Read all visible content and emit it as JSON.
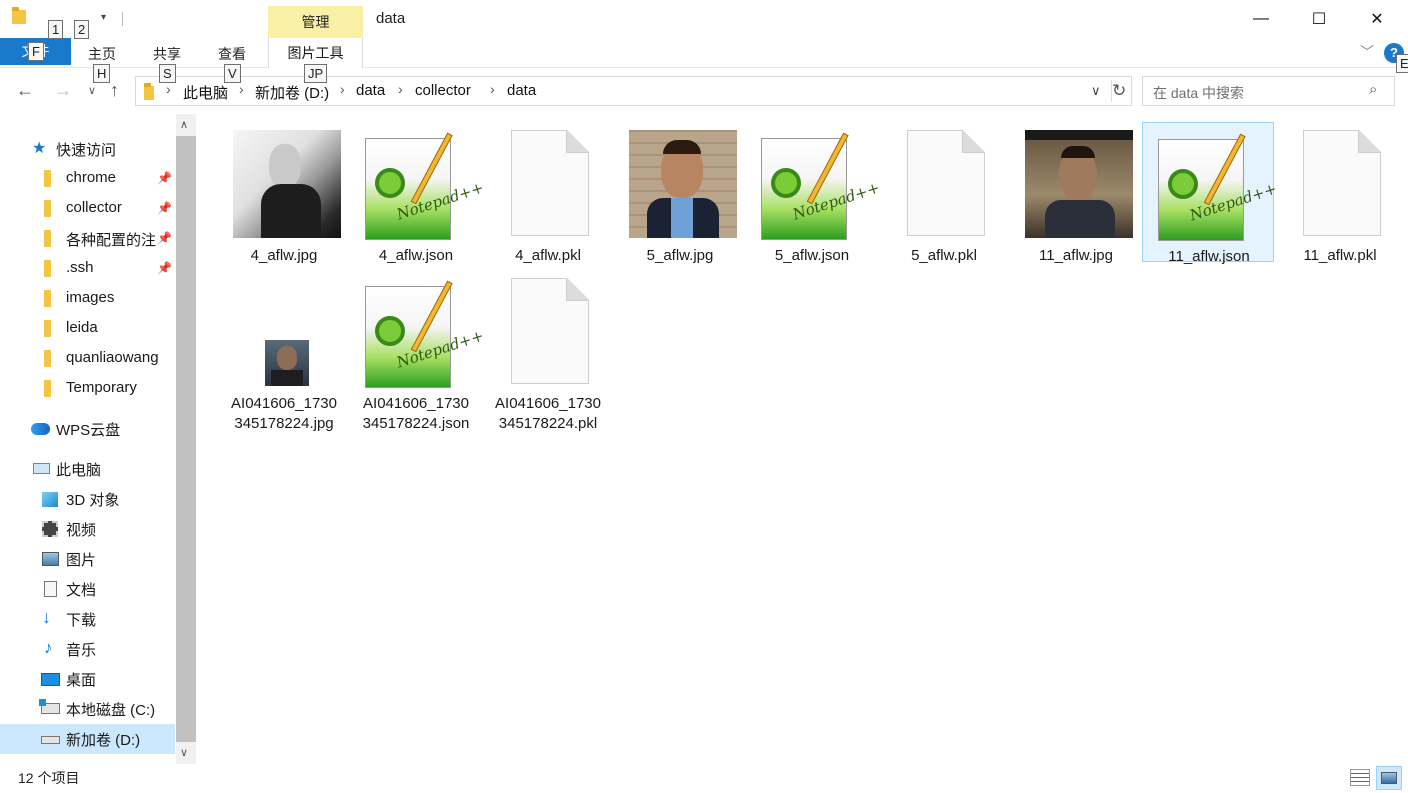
{
  "window": {
    "title": "data",
    "manage_tab": "管理",
    "keytips_top": [
      "1",
      "2"
    ],
    "minimize": "—",
    "maximize": "☐",
    "close": "✕"
  },
  "ribbon": {
    "file_tab": "文件",
    "file_keytip": "F",
    "tabs": [
      {
        "label": "主页",
        "keytip": "H"
      },
      {
        "label": "共享",
        "keytip": "S"
      },
      {
        "label": "查看",
        "keytip": "V"
      },
      {
        "label": "图片工具",
        "keytip": "JP"
      }
    ],
    "help_keytip": "E"
  },
  "address": {
    "crumbs": [
      "此电脑",
      "新加卷 (D:)",
      "data",
      "collector",
      "data"
    ],
    "search_placeholder": "在 data 中搜索"
  },
  "sidebar": {
    "quick_access": "快速访问",
    "pinned": [
      "chrome",
      "collector",
      "各种配置的注",
      ".ssh"
    ],
    "folders": [
      "images",
      "leida",
      "quanliaowang",
      "Temporary"
    ],
    "wps": "WPS云盘",
    "this_pc": "此电脑",
    "pc_items": [
      "3D 对象",
      "视频",
      "图片",
      "文档",
      "下载",
      "音乐",
      "桌面",
      "本地磁盘 (C:)",
      "新加卷 (D:)"
    ]
  },
  "files": [
    {
      "name": "4_aflw.jpg",
      "kind": "photo-bw"
    },
    {
      "name": "4_aflw.json",
      "kind": "notepad"
    },
    {
      "name": "4_aflw.pkl",
      "kind": "blank"
    },
    {
      "name": "5_aflw.jpg",
      "kind": "photo-brick"
    },
    {
      "name": "5_aflw.json",
      "kind": "notepad"
    },
    {
      "name": "5_aflw.pkl",
      "kind": "blank"
    },
    {
      "name": "11_aflw.jpg",
      "kind": "photo-dark"
    },
    {
      "name": "11_aflw.json",
      "kind": "notepad",
      "selected": true
    },
    {
      "name": "11_aflw.pkl",
      "kind": "blank"
    },
    {
      "name": "AI041606_1730\n345178224.jpg",
      "kind": "photo-small"
    },
    {
      "name": "AI041606_1730\n345178224.json",
      "kind": "notepad"
    },
    {
      "name": "AI041606_1730\n345178224.pkl",
      "kind": "blank"
    }
  ],
  "status": {
    "item_count": "12 个项目"
  },
  "colors": {
    "accent": "#1979ca",
    "selection": "#cce8ff",
    "manage_tab": "#f9f0a5"
  }
}
